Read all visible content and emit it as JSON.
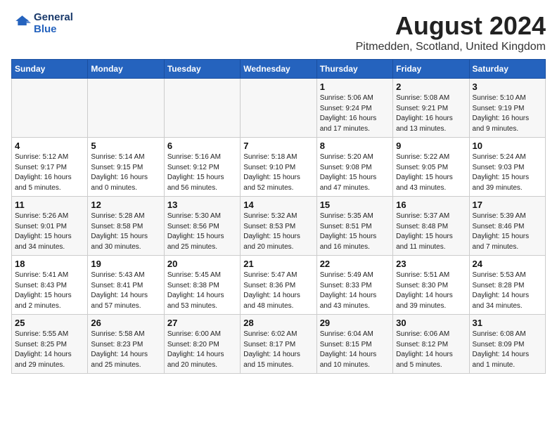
{
  "header": {
    "logo_line1": "General",
    "logo_line2": "Blue",
    "main_title": "August 2024",
    "subtitle": "Pitmedden, Scotland, United Kingdom"
  },
  "weekdays": [
    "Sunday",
    "Monday",
    "Tuesday",
    "Wednesday",
    "Thursday",
    "Friday",
    "Saturday"
  ],
  "weeks": [
    {
      "days": [
        {
          "num": "",
          "info": ""
        },
        {
          "num": "",
          "info": ""
        },
        {
          "num": "",
          "info": ""
        },
        {
          "num": "",
          "info": ""
        },
        {
          "num": "1",
          "info": "Sunrise: 5:06 AM\nSunset: 9:24 PM\nDaylight: 16 hours\nand 17 minutes."
        },
        {
          "num": "2",
          "info": "Sunrise: 5:08 AM\nSunset: 9:21 PM\nDaylight: 16 hours\nand 13 minutes."
        },
        {
          "num": "3",
          "info": "Sunrise: 5:10 AM\nSunset: 9:19 PM\nDaylight: 16 hours\nand 9 minutes."
        }
      ]
    },
    {
      "days": [
        {
          "num": "4",
          "info": "Sunrise: 5:12 AM\nSunset: 9:17 PM\nDaylight: 16 hours\nand 5 minutes."
        },
        {
          "num": "5",
          "info": "Sunrise: 5:14 AM\nSunset: 9:15 PM\nDaylight: 16 hours\nand 0 minutes."
        },
        {
          "num": "6",
          "info": "Sunrise: 5:16 AM\nSunset: 9:12 PM\nDaylight: 15 hours\nand 56 minutes."
        },
        {
          "num": "7",
          "info": "Sunrise: 5:18 AM\nSunset: 9:10 PM\nDaylight: 15 hours\nand 52 minutes."
        },
        {
          "num": "8",
          "info": "Sunrise: 5:20 AM\nSunset: 9:08 PM\nDaylight: 15 hours\nand 47 minutes."
        },
        {
          "num": "9",
          "info": "Sunrise: 5:22 AM\nSunset: 9:05 PM\nDaylight: 15 hours\nand 43 minutes."
        },
        {
          "num": "10",
          "info": "Sunrise: 5:24 AM\nSunset: 9:03 PM\nDaylight: 15 hours\nand 39 minutes."
        }
      ]
    },
    {
      "days": [
        {
          "num": "11",
          "info": "Sunrise: 5:26 AM\nSunset: 9:01 PM\nDaylight: 15 hours\nand 34 minutes."
        },
        {
          "num": "12",
          "info": "Sunrise: 5:28 AM\nSunset: 8:58 PM\nDaylight: 15 hours\nand 30 minutes."
        },
        {
          "num": "13",
          "info": "Sunrise: 5:30 AM\nSunset: 8:56 PM\nDaylight: 15 hours\nand 25 minutes."
        },
        {
          "num": "14",
          "info": "Sunrise: 5:32 AM\nSunset: 8:53 PM\nDaylight: 15 hours\nand 20 minutes."
        },
        {
          "num": "15",
          "info": "Sunrise: 5:35 AM\nSunset: 8:51 PM\nDaylight: 15 hours\nand 16 minutes."
        },
        {
          "num": "16",
          "info": "Sunrise: 5:37 AM\nSunset: 8:48 PM\nDaylight: 15 hours\nand 11 minutes."
        },
        {
          "num": "17",
          "info": "Sunrise: 5:39 AM\nSunset: 8:46 PM\nDaylight: 15 hours\nand 7 minutes."
        }
      ]
    },
    {
      "days": [
        {
          "num": "18",
          "info": "Sunrise: 5:41 AM\nSunset: 8:43 PM\nDaylight: 15 hours\nand 2 minutes."
        },
        {
          "num": "19",
          "info": "Sunrise: 5:43 AM\nSunset: 8:41 PM\nDaylight: 14 hours\nand 57 minutes."
        },
        {
          "num": "20",
          "info": "Sunrise: 5:45 AM\nSunset: 8:38 PM\nDaylight: 14 hours\nand 53 minutes."
        },
        {
          "num": "21",
          "info": "Sunrise: 5:47 AM\nSunset: 8:36 PM\nDaylight: 14 hours\nand 48 minutes."
        },
        {
          "num": "22",
          "info": "Sunrise: 5:49 AM\nSunset: 8:33 PM\nDaylight: 14 hours\nand 43 minutes."
        },
        {
          "num": "23",
          "info": "Sunrise: 5:51 AM\nSunset: 8:30 PM\nDaylight: 14 hours\nand 39 minutes."
        },
        {
          "num": "24",
          "info": "Sunrise: 5:53 AM\nSunset: 8:28 PM\nDaylight: 14 hours\nand 34 minutes."
        }
      ]
    },
    {
      "days": [
        {
          "num": "25",
          "info": "Sunrise: 5:55 AM\nSunset: 8:25 PM\nDaylight: 14 hours\nand 29 minutes."
        },
        {
          "num": "26",
          "info": "Sunrise: 5:58 AM\nSunset: 8:23 PM\nDaylight: 14 hours\nand 25 minutes."
        },
        {
          "num": "27",
          "info": "Sunrise: 6:00 AM\nSunset: 8:20 PM\nDaylight: 14 hours\nand 20 minutes."
        },
        {
          "num": "28",
          "info": "Sunrise: 6:02 AM\nSunset: 8:17 PM\nDaylight: 14 hours\nand 15 minutes."
        },
        {
          "num": "29",
          "info": "Sunrise: 6:04 AM\nSunset: 8:15 PM\nDaylight: 14 hours\nand 10 minutes."
        },
        {
          "num": "30",
          "info": "Sunrise: 6:06 AM\nSunset: 8:12 PM\nDaylight: 14 hours\nand 5 minutes."
        },
        {
          "num": "31",
          "info": "Sunrise: 6:08 AM\nSunset: 8:09 PM\nDaylight: 14 hours\nand 1 minute."
        }
      ]
    }
  ]
}
